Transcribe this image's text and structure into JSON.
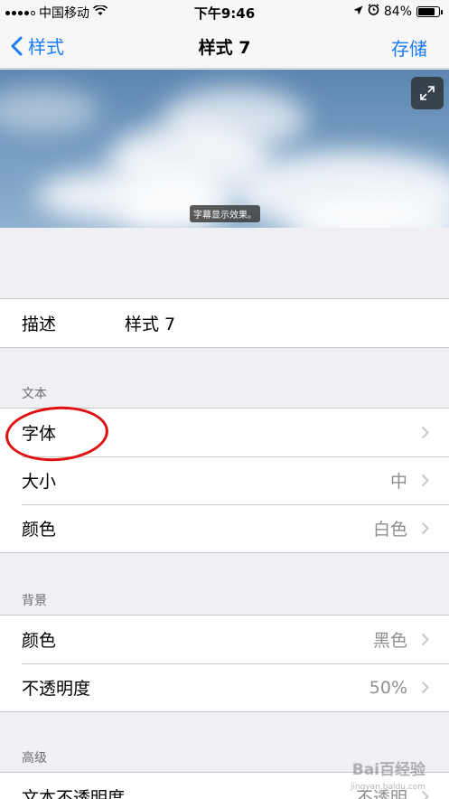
{
  "status_bar": {
    "carrier": "中国移动",
    "time": "下午9:46",
    "battery_percent_text": "84%",
    "battery_level": 0.84
  },
  "nav": {
    "back_label": "样式",
    "title": "样式 7",
    "save_label": "存储"
  },
  "preview": {
    "caption": "字幕显示效果。"
  },
  "description_row": {
    "label": "描述",
    "value": "样式 7"
  },
  "text_section": {
    "header": "文本",
    "rows": [
      {
        "label": "字体",
        "value": ""
      },
      {
        "label": "大小",
        "value": "中"
      },
      {
        "label": "颜色",
        "value": "白色"
      }
    ]
  },
  "background_section": {
    "header": "背景",
    "rows": [
      {
        "label": "颜色",
        "value": "黑色"
      },
      {
        "label": "不透明度",
        "value": "50%"
      }
    ]
  },
  "advanced_section": {
    "header": "高级",
    "rows": [
      {
        "label": "文本不透明度",
        "value": "不透明"
      }
    ]
  },
  "watermark": {
    "text": "Bai百经验",
    "sub": "jingyan.baidu.com"
  },
  "colors": {
    "accent": "#1a7cf5",
    "annotation": "#e01010"
  },
  "icons": [
    "chevron-left-icon",
    "expand-icon",
    "chevron-right-icon",
    "wifi-icon",
    "location-icon",
    "alarm-icon",
    "battery-icon"
  ]
}
